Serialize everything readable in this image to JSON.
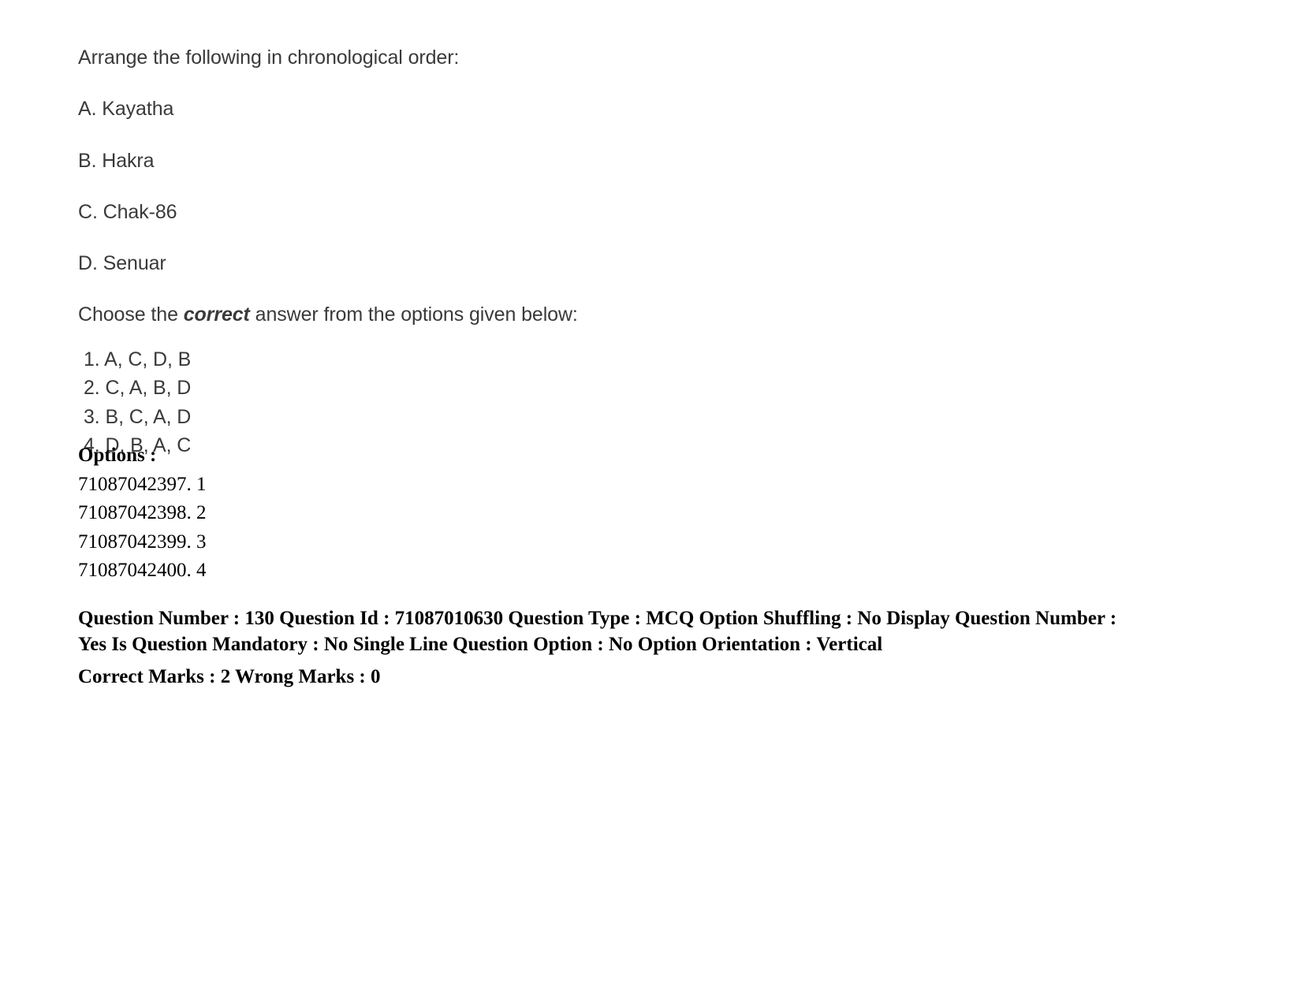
{
  "question": {
    "stem": "Arrange the following in chronological order:",
    "statements": [
      "A. Kayatha",
      "B. Hakra",
      "C. Chak-86",
      "D. Senuar"
    ],
    "choose_prefix": "Choose the ",
    "choose_emphasis": "correct",
    "choose_suffix": " answer from the options given below:",
    "answer_options": [
      "1. A, C, D, B",
      "2. C, A, B, D",
      "3. B, C, A, D",
      "4. D, B, A, C"
    ]
  },
  "options_block": {
    "heading": "Options :",
    "entries": [
      "71087042397. 1",
      "71087042398. 2",
      "71087042399. 3",
      "71087042400. 4"
    ]
  },
  "metadata": {
    "details": "Question Number : 130 Question Id : 71087010630 Question Type : MCQ Option Shuffling : No Display Question Number : Yes Is Question Mandatory : No Single Line Question Option : No Option Orientation : Vertical",
    "marks": "Correct Marks : 2 Wrong Marks : 0",
    "question_number": "130",
    "question_id": "71087010630",
    "question_type": "MCQ",
    "option_shuffling": "No",
    "display_question_number": "Yes",
    "is_question_mandatory": "No",
    "single_line_question_option": "No",
    "option_orientation": "Vertical",
    "correct_marks": "2",
    "wrong_marks": "0"
  },
  "colors": {
    "page_background": "#ffffff",
    "body_text": "#3a3a3a",
    "meta_text": "#000000"
  }
}
